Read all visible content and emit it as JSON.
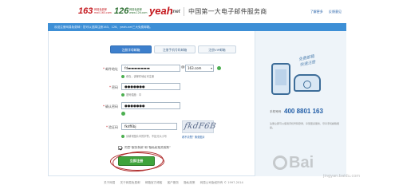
{
  "header": {
    "logo_163": "163",
    "logo_163_sub": "网易免费邮 mail.163.com",
    "logo_126": "126",
    "logo_126_sub": "网易免费邮 www.126.com",
    "logo_yeah": "yeah",
    "logo_yeah_net": ".net",
    "tagline": "中国第一大电子邮件服务商",
    "links": [
      "了解更多",
      "反馈意见"
    ]
  },
  "notice": "欢迎注册网易免费邮！您可以选择注册163、126、yeah.net三大免费邮箱。",
  "tabs": [
    "注册字母邮箱",
    "注册手机号码邮箱",
    "注册VIP邮箱"
  ],
  "form": {
    "email_label": "邮件地址",
    "email_value": "fd▬▬▬▬▬▬▬",
    "at": "@",
    "domain_value": "163.com",
    "email_hint": "恭喜，该邮件地址可注册",
    "password_label": "密码",
    "password_value": "●●●●●●●",
    "password_hint": "密码强度：中",
    "confirm_label": "确认密码",
    "confirm_value": "●●●●●●●",
    "captcha_label": "验证码",
    "captcha_value": "fkdf6bj",
    "captcha_image_text": "fkdF6B",
    "captcha_refresh": "看不清楚？换张图片",
    "captcha_hint": "请填写图片中的字符，不区分大小写",
    "agree_text": "同意“服务条款”和“隐私权相关政策”",
    "submit_label": "立即注册"
  },
  "right_panel": {
    "slogan_line1": "免费邮箱",
    "slogan_line2": "快速注册",
    "hotline_label": "手机号码",
    "hotline_number": "400 8801 163",
    "note": "注册立即可以使用手机号码登录，享受更多服务，尽享手机邮箱便捷。"
  },
  "footer": {
    "links": [
      "关于网易",
      "关于网易免费邮",
      "邮箱官方博客",
      "客户服务",
      "隐私政策",
      "网易公司版权所有 © 1997-2014"
    ]
  },
  "watermark": {
    "text": "Bai",
    "sub": "jingyan.baidu.com"
  },
  "colors": {
    "brand_red": "#c4161c",
    "accent_blue": "#3d8fd6",
    "submit_green": "#3fa33b"
  }
}
